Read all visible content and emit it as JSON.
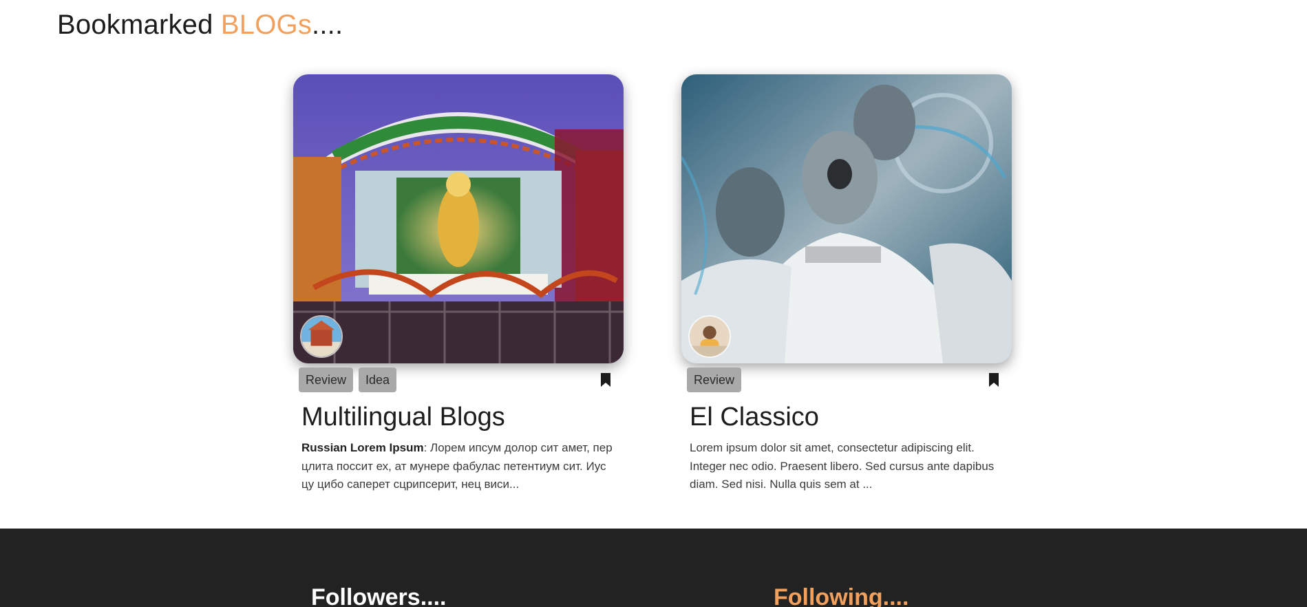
{
  "heading": {
    "prefix": "Bookmarked ",
    "accent": "BLOGs",
    "suffix": "....",
    "accent_color": "#f2a05c"
  },
  "cards": [
    {
      "tags": [
        "Review",
        "Idea"
      ],
      "title": "Multilingual Blogs",
      "excerpt_bold": "Russian Lorem Ipsum",
      "excerpt": ": Лорем ипсум долор сит амет, пер цлита поссит ех, ат мунере фабулас петентиум сит. Иус цу цибо саперет сцрипсерит, нец виси...",
      "image_icon": "temple-photo-icon",
      "avatar_icon": "author-avatar-icon",
      "bookmark_icon": "bookmark-icon"
    },
    {
      "tags": [
        "Review"
      ],
      "title": "El Classico",
      "excerpt_bold": "",
      "excerpt": "Lorem ipsum dolor sit amet, consectetur adipiscing elit. Integer nec odio. Praesent libero. Sed cursus ante dapibus diam. Sed nisi. Nulla quis sem at ...",
      "image_icon": "football-photo-icon",
      "avatar_icon": "author-avatar-icon",
      "bookmark_icon": "bookmark-icon"
    }
  ],
  "footer": {
    "followers_title": "Followers....",
    "following_title": "Following....",
    "background": "#222222"
  }
}
